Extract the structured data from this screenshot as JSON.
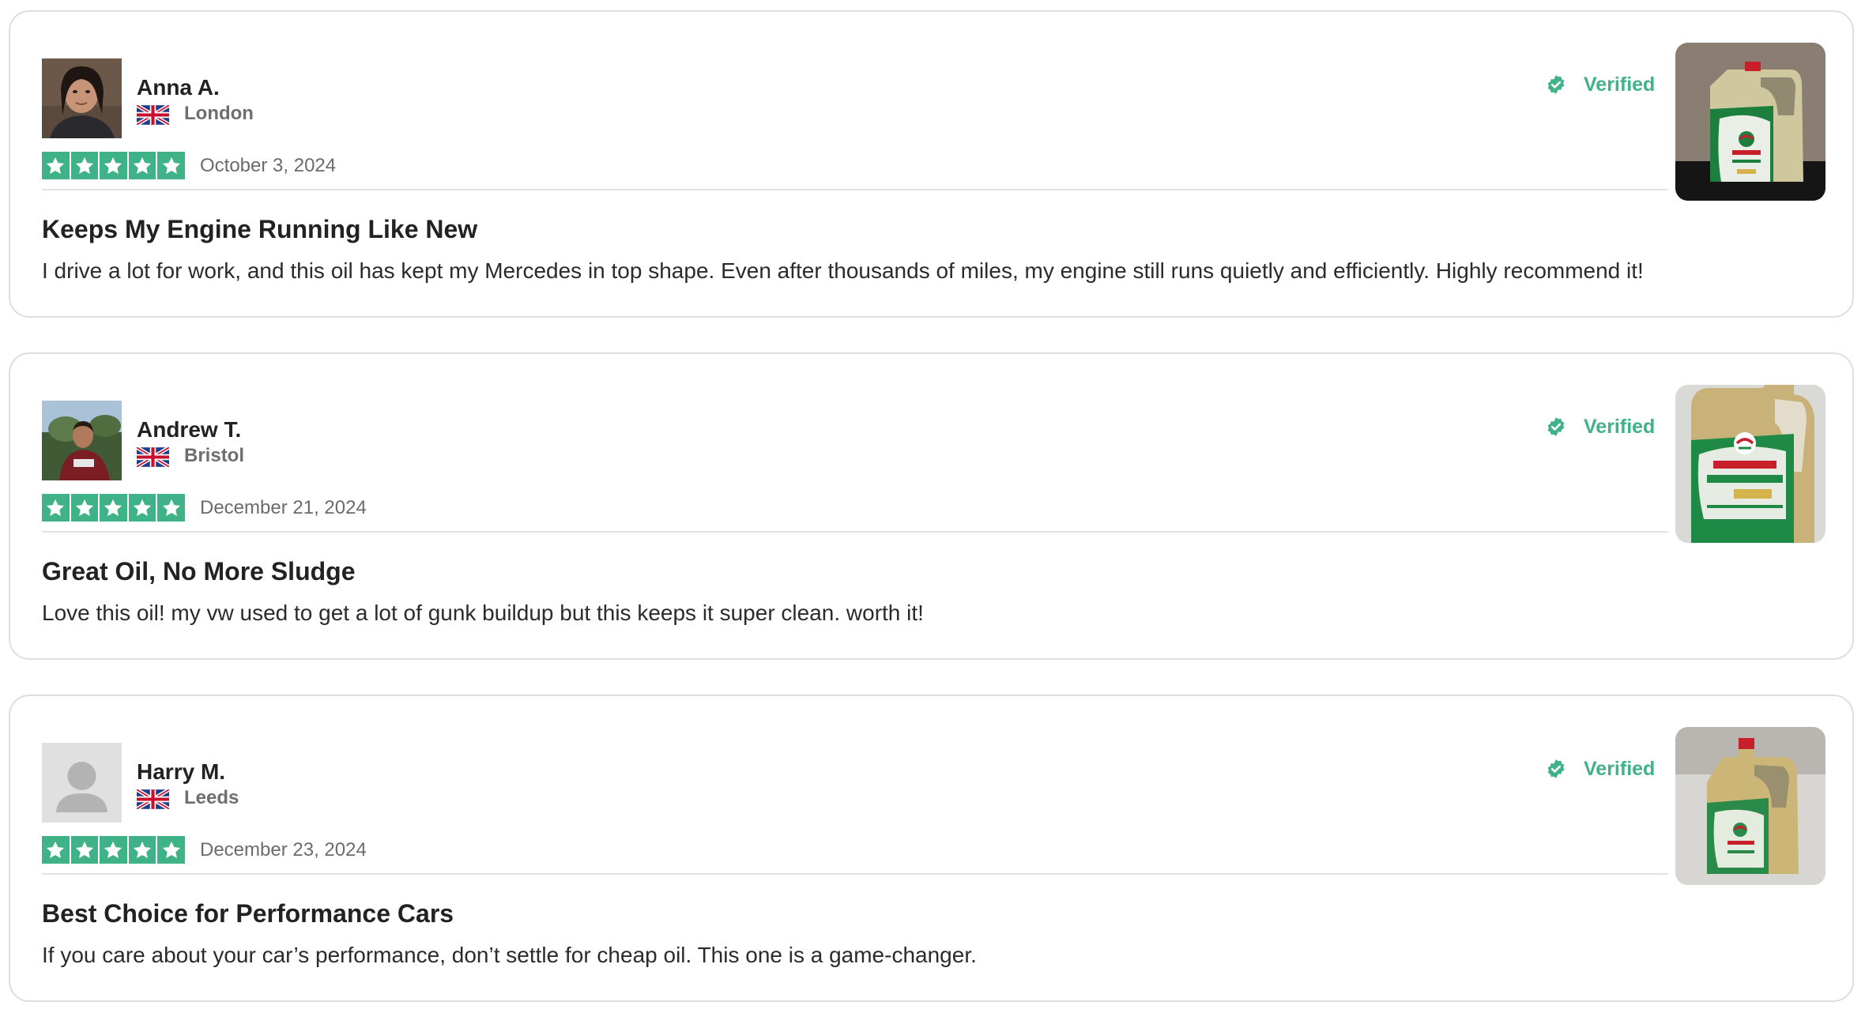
{
  "reviews": [
    {
      "name": "Anna A.",
      "location": "London",
      "rating": 5,
      "date": "October 3, 2024",
      "verified_label": "Verified",
      "title": "Keeps My Engine Running Like New",
      "body": "I drive a lot for work, and this oil has kept my Mercedes in top shape. Even after thousands of miles, my engine still runs quietly and efficiently. Highly recommend it!",
      "avatar": "woman-portrait-photo",
      "product_photo": "castrol-edge-bottle-photo"
    },
    {
      "name": "Andrew T.",
      "location": "Bristol",
      "rating": 5,
      "date": "December 21, 2024",
      "verified_label": "Verified",
      "title": "Great Oil, No More Sludge",
      "body": "Love this oil! my vw used to get a lot of gunk buildup but this keeps it super clean. worth it!",
      "avatar": "man-outdoor-photo",
      "product_photo": "castrol-edge-bottle-photo"
    },
    {
      "name": "Harry M.",
      "location": "Leeds",
      "rating": 5,
      "date": "December 23, 2024",
      "verified_label": "Verified",
      "title": "Best Choice for Performance Cars",
      "body": "If you care about your car’s performance, don’t settle for cheap oil. This one is a game-changer.",
      "avatar": "default-user-icon",
      "product_photo": "castrol-edge-bottle-photo"
    }
  ],
  "colors": {
    "accent_green": "#3fb387",
    "card_border": "#dedede",
    "muted_text": "#6b6b6b"
  }
}
